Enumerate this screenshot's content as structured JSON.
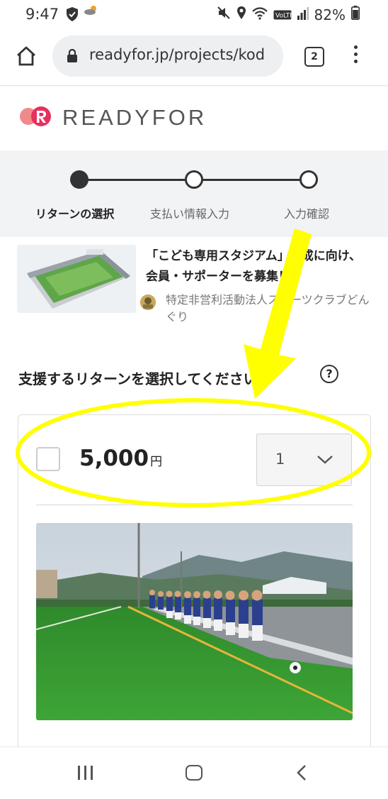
{
  "status_bar": {
    "time": "9:47",
    "battery": "82%",
    "icons": [
      "shield-icon",
      "weather-icon",
      "mute-icon",
      "location-icon",
      "wifi-icon",
      "volte-icon",
      "signal-icon",
      "battery-icon"
    ]
  },
  "browser": {
    "url": "readyfor.jp/projects/kod",
    "tab_count": "2"
  },
  "brand": {
    "name": "READYFOR",
    "accent": "#e6305f"
  },
  "steps": [
    {
      "label": "リターンの選択",
      "state": "active"
    },
    {
      "label": "支払い情報入力",
      "state": "inactive"
    },
    {
      "label": "入力確認",
      "state": "inactive"
    }
  ],
  "project": {
    "title": "「こども専用スタジアム」完成に向け、会員・サポーターを募集！",
    "organization": "特定非営利活動法人スポーツクラブどんぐり"
  },
  "select_heading": "支援するリターンを選択してください",
  "help_label": "?",
  "return_item": {
    "price": "5,000",
    "currency": "円",
    "quantity": "1",
    "checked": false
  },
  "annotation": {
    "color": "#ffff00"
  }
}
